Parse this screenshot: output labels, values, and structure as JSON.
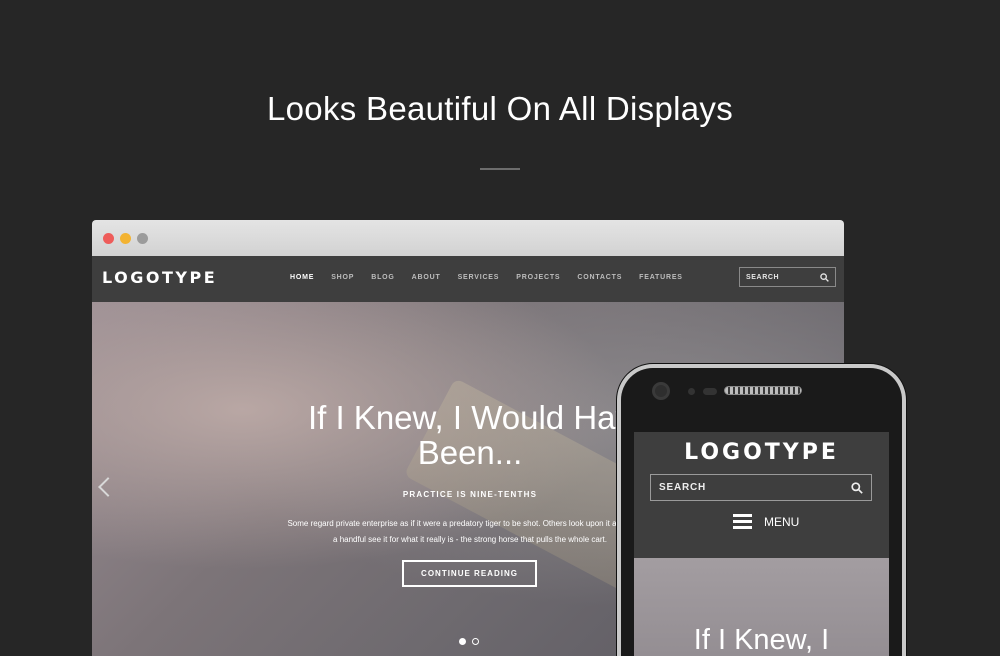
{
  "page": {
    "headline": "Looks Beautiful On All Displays"
  },
  "browser": {
    "window_dots": [
      {
        "name": "close",
        "color": "#ee5c5a"
      },
      {
        "name": "minimize",
        "color": "#f3b332"
      },
      {
        "name": "maximize",
        "color": "#9b9b9b"
      }
    ],
    "site": {
      "logo": "LOGOTYPE",
      "nav": [
        {
          "label": "HOME",
          "active": true
        },
        {
          "label": "SHOP",
          "active": false
        },
        {
          "label": "BLOG",
          "active": false
        },
        {
          "label": "ABOUT",
          "active": false
        },
        {
          "label": "SERVICES",
          "active": false
        },
        {
          "label": "PROJECTS",
          "active": false
        },
        {
          "label": "CONTACTS",
          "active": false
        },
        {
          "label": "FEATURES",
          "active": false
        }
      ],
      "search_label": "SEARCH",
      "hero": {
        "title_line1": "If I Knew, I Would Hav",
        "title_line2": "Been...",
        "subtitle": "PRACTICE IS NINE-TENTHS",
        "text_line1": "Some regard private enterprise as if it were a predatory tiger to be shot. Others look upon it as a cow th",
        "text_line2": "a handful see it for what it really is - the strong horse that pulls the whole cart.",
        "button": "CONTINUE READING",
        "active_slide": 1,
        "slide_count": 2
      }
    }
  },
  "phone": {
    "logo": "LOGOTYPE",
    "search_label": "SEARCH",
    "menu_label": "MENU",
    "hero_title": "If I Knew, I"
  },
  "colors": {
    "background": "#262626",
    "nav_bar": "#3e3e3e"
  }
}
